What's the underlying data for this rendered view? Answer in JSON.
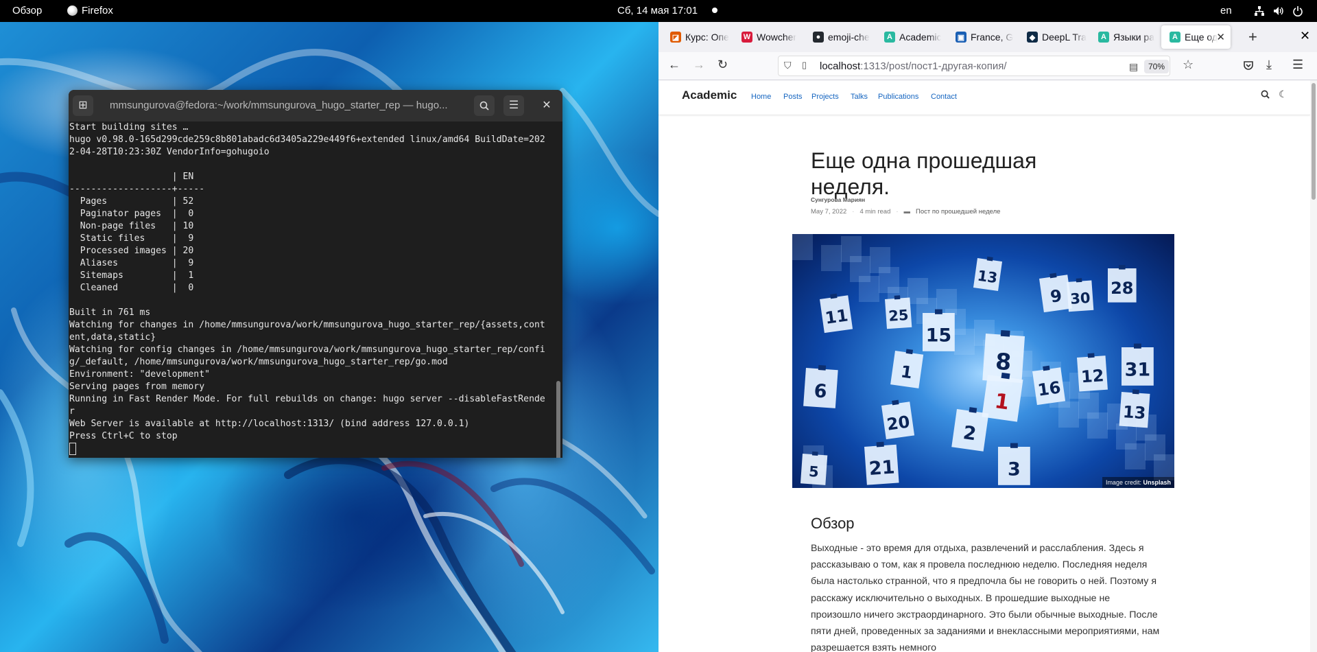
{
  "topbar": {
    "overview": "Обзор",
    "app_name": "Firefox",
    "clock": "Сб, 14 мая  17:01",
    "language": "en"
  },
  "terminal": {
    "title": "mmsungurova@fedora:~/work/mmsungurova_hugo_starter_rep — hugo...",
    "lines": [
      "Start building sites …",
      "hugo v0.98.0-165d299cde259c8b801abadc6d3405a229e449f6+extended linux/amd64 BuildDate=202",
      "2-04-28T10:23:30Z VendorInfo=gohugoio",
      "",
      "                   | EN",
      "-------------------+-----",
      "  Pages            | 52",
      "  Paginator pages  |  0",
      "  Non-page files   | 10",
      "  Static files     |  9",
      "  Processed images | 20",
      "  Aliases          |  9",
      "  Sitemaps         |  1",
      "  Cleaned          |  0",
      "",
      "Built in 761 ms",
      "Watching for changes in /home/mmsungurova/work/mmsungurova_hugo_starter_rep/{assets,cont",
      "ent,data,static}",
      "Watching for config changes in /home/mmsungurova/work/mmsungurova_hugo_starter_rep/confi",
      "g/_default, /home/mmsungurova/work/mmsungurova_hugo_starter_rep/go.mod",
      "Environment: \"development\"",
      "Serving pages from memory",
      "Running in Fast Render Mode. For full rebuilds on change: hugo server --disableFastRende",
      "r",
      "Web Server is available at http://localhost:1313/ (bind address 127.0.0.1)",
      "Press Ctrl+C to stop"
    ]
  },
  "browser": {
    "tabs": [
      {
        "label": "Курс: Опе",
        "icon": "moodle-icon",
        "color": "#e05a00",
        "glyph": "◪"
      },
      {
        "label": "Wowcher",
        "icon": "wowcher-icon",
        "color": "#d81b3c",
        "glyph": "W"
      },
      {
        "label": "emoji-che",
        "icon": "github-icon",
        "color": "#24292f",
        "glyph": "●"
      },
      {
        "label": "Academic",
        "icon": "academic-icon",
        "color": "#2ab9a0",
        "glyph": "A"
      },
      {
        "label": "France, G",
        "icon": "wiki-icon",
        "color": "#1a5fb4",
        "glyph": "▣"
      },
      {
        "label": "DeepL Tra",
        "icon": "deepl-icon",
        "color": "#0f2b46",
        "glyph": "◆"
      },
      {
        "label": "Языки ра",
        "icon": "academic-icon",
        "color": "#2ab9a0",
        "glyph": "A"
      },
      {
        "label": "Еще од",
        "icon": "academic-icon",
        "color": "#2ab9a0",
        "glyph": "A"
      }
    ],
    "url_host": "localhost",
    "url_path": ":1313/post/пост1-другая-копия/",
    "zoom": "70%"
  },
  "site": {
    "brand": "Academic",
    "nav": [
      "Home",
      "Posts",
      "Projects",
      "Talks",
      "Publications",
      "Contact"
    ]
  },
  "article": {
    "title": "Еще одна прошедшая неделя.",
    "author": "Сунгурова Мариян",
    "date": "May 7, 2022",
    "read_time": "4 min read",
    "category": "Пост по прошедшей неделе",
    "image_credit_prefix": "Image credit:",
    "image_credit_source": "Unsplash",
    "section_heading": "Обзор",
    "paragraph": "Выходные - это время для отдыха, развлечений и расслабления. Здесь я рассказываю о том, как я провела последнюю неделю. Последняя неделя была настолько странной, что я предпочла бы не говорить о ней. Поэтому я расскажу исключительно о выходных. В прошедшие выходные не произошло ничего экстраординарного. Это были обычные выходные. После пяти дней, проведенных за заданиями и внеклассными мероприятиями, нам разрешается взять немного"
  },
  "calendar_numbers": [
    "11",
    "25",
    "15",
    "8",
    "13",
    "9",
    "30",
    "28",
    "6",
    "1",
    "16",
    "12",
    "31",
    "13",
    "2",
    "20",
    "21",
    "3",
    "5",
    "1"
  ]
}
